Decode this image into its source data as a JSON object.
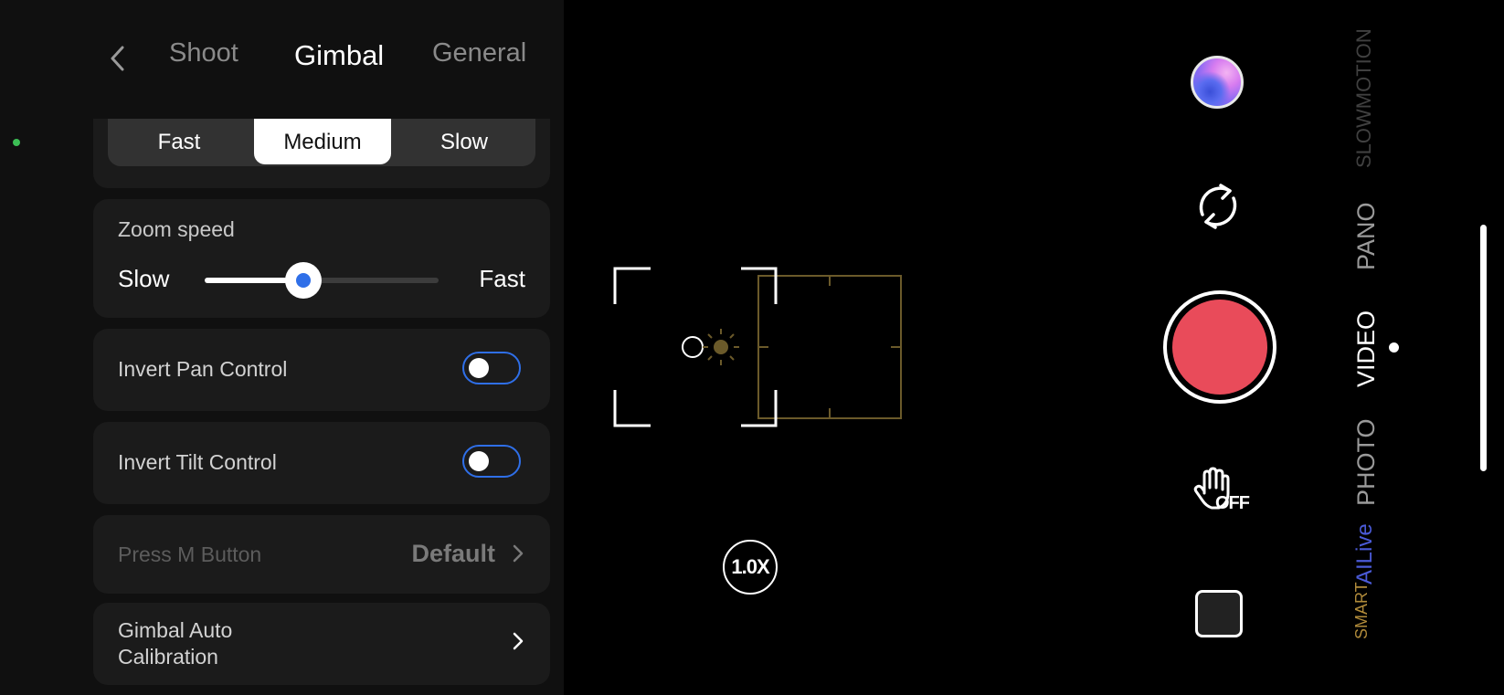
{
  "tabs": {
    "back_label": "‹",
    "shoot": "Shoot",
    "gimbal": "Gimbal",
    "general": "General"
  },
  "speed_segment": {
    "options": [
      "Fast",
      "Medium",
      "Slow"
    ],
    "selected": "Medium"
  },
  "zoom_speed": {
    "title": "Zoom speed",
    "min_label": "Slow",
    "max_label": "Fast",
    "value_fraction": 0.42
  },
  "invert_pan": {
    "label": "Invert Pan Control",
    "enabled": false
  },
  "invert_tilt": {
    "label": "Invert Tilt Control",
    "enabled": false
  },
  "press_m": {
    "label": "Press M Button",
    "value": "Default"
  },
  "calibration": {
    "label": "Gimbal Auto Calibration"
  },
  "zoom_badge": "1.0X",
  "gesture_label": "OFF",
  "modes": {
    "slowmotion": "SLOWMOTION",
    "pano": "PANO",
    "video": "VIDEO",
    "photo": "PHOTO",
    "ailive": "AILive",
    "smart": "SMART",
    "selected": "VIDEO"
  },
  "colors": {
    "accent": "#2f6fe8",
    "record": "#e94b5a",
    "status": "#3cbe55",
    "focus_box": "#6b5a2a",
    "ailive": "#4a5ad7"
  },
  "icons": [
    "back-chevron-icon",
    "switch-camera-icon",
    "hand-gesture-icon",
    "chevron-right-icon",
    "exposure-sun-icon"
  ]
}
